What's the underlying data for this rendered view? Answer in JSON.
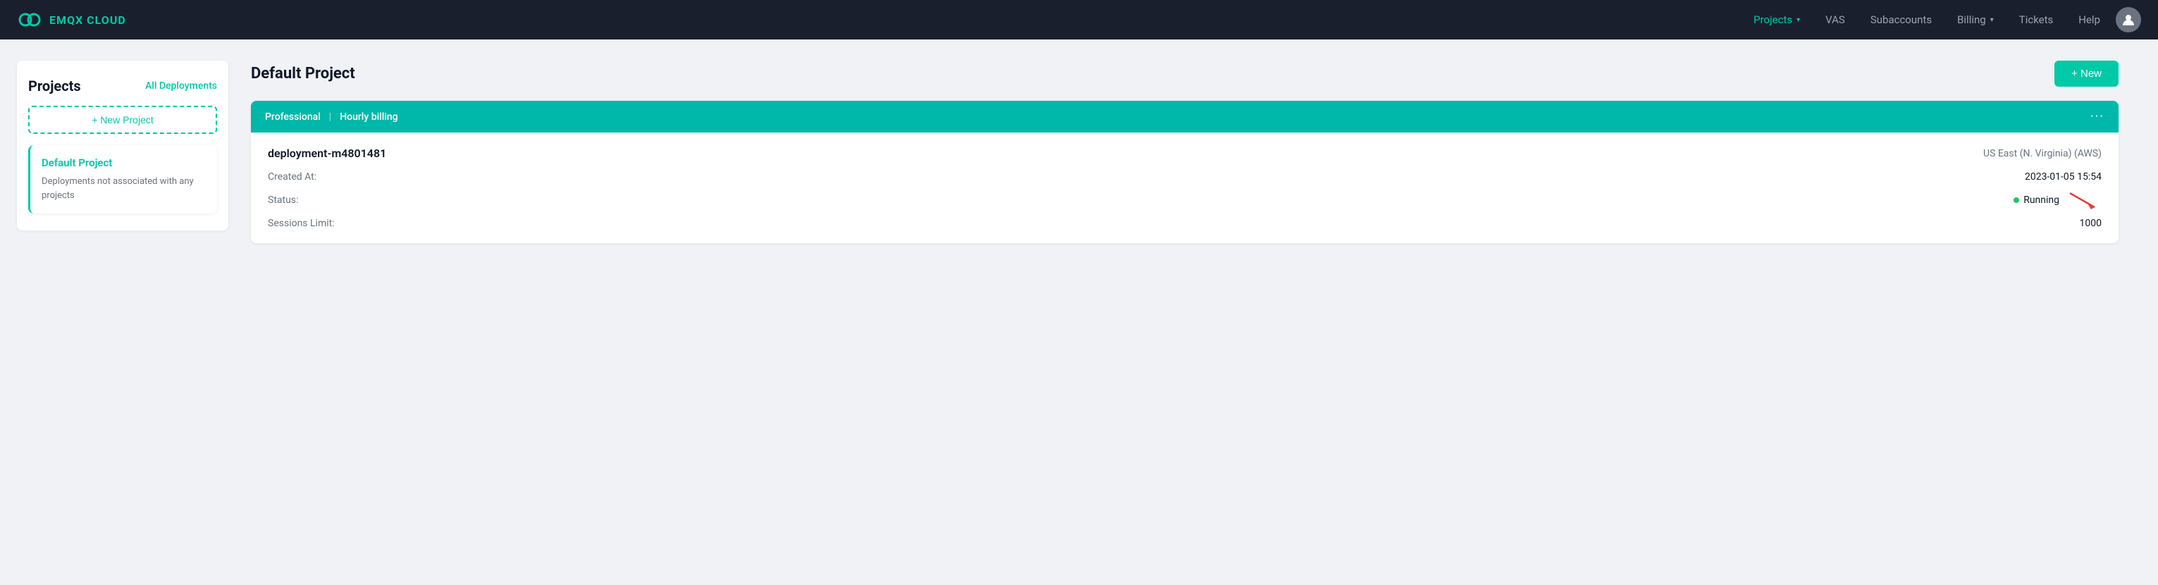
{
  "app": {
    "title": "EMQX CLOUD"
  },
  "nav": {
    "items": [
      {
        "label": "Projects",
        "active": true,
        "hasDropdown": true
      },
      {
        "label": "VAS",
        "active": false,
        "hasDropdown": false
      },
      {
        "label": "Subaccounts",
        "active": false,
        "hasDropdown": false
      },
      {
        "label": "Billing",
        "active": false,
        "hasDropdown": true
      },
      {
        "label": "Tickets",
        "active": false,
        "hasDropdown": false
      },
      {
        "label": "Help",
        "active": false,
        "hasDropdown": false
      }
    ]
  },
  "sidebar": {
    "title": "Projects",
    "all_deployments_link": "All Deployments",
    "new_project_btn": "+ New Project",
    "project": {
      "name": "Default Project",
      "description": "Deployments not associated with any projects"
    }
  },
  "content": {
    "project_title": "Default Project",
    "new_btn": "+ New",
    "deployment_card": {
      "header_tag1": "Professional",
      "header_divider": "|",
      "header_tag2": "Hourly billing",
      "dots": "···",
      "name": "deployment-m4801481",
      "region": "US East (N. Virginia) (AWS)",
      "created_at_label": "Created At:",
      "created_at_value": "2023-01-05 15:54",
      "status_label": "Status:",
      "status_value": "Running",
      "sessions_limit_label": "Sessions Limit:",
      "sessions_limit_value": "1000"
    }
  }
}
